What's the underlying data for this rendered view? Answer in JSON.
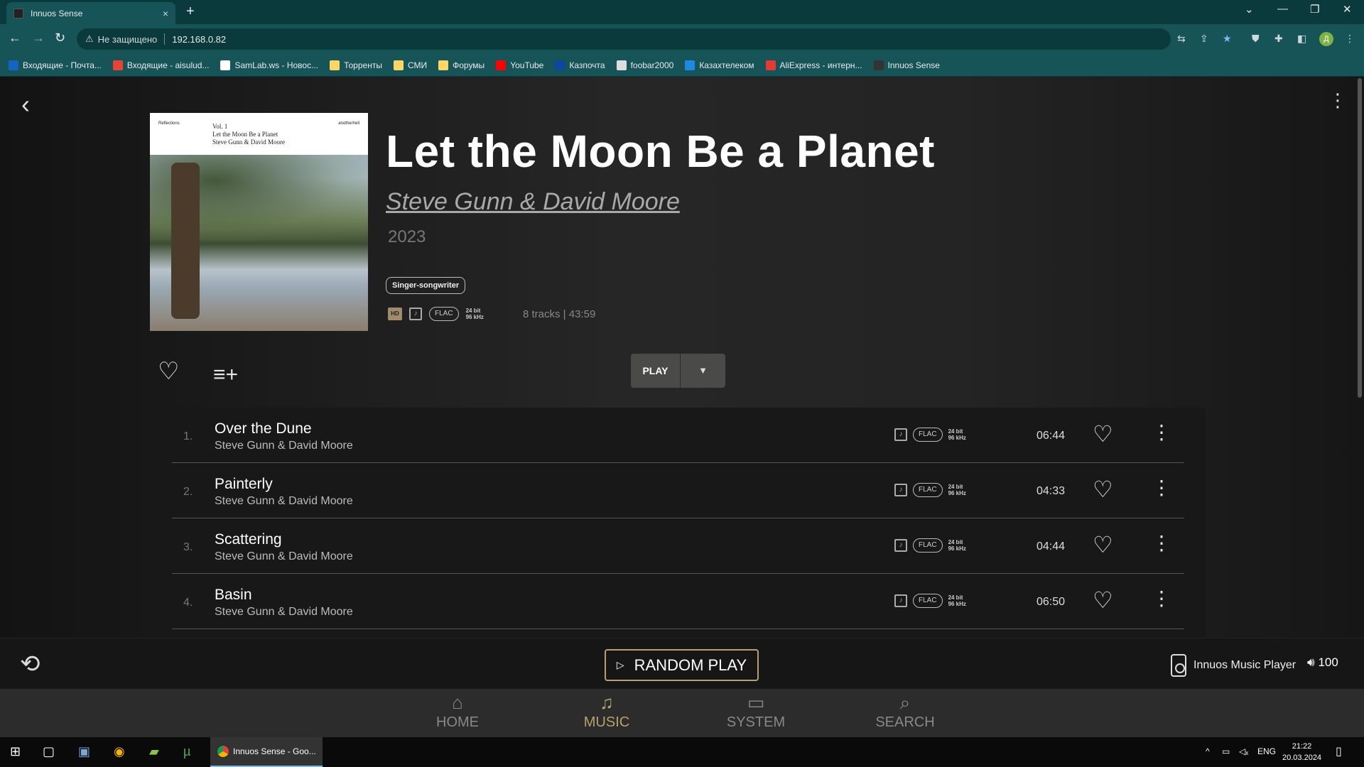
{
  "browser": {
    "tab_title": "Innuos Sense",
    "tab_close": "×",
    "new_tab": "+",
    "security_label": "Не защищено",
    "url": "192.168.0.82",
    "avatar_letter": "Д",
    "bookmarks": [
      {
        "label": "Входящие - Почта...",
        "color": "#1565c0"
      },
      {
        "label": "Входящие - aisulud...",
        "color": "#ea4335"
      },
      {
        "label": "SamLab.ws - Новос...",
        "color": "#ffffff"
      },
      {
        "label": "Торренты",
        "color": "#fdd663"
      },
      {
        "label": "СМИ",
        "color": "#fdd663"
      },
      {
        "label": "Форумы",
        "color": "#fdd663"
      },
      {
        "label": "YouTube",
        "color": "#ff0000"
      },
      {
        "label": "Казпочта",
        "color": "#0d47a1"
      },
      {
        "label": "foobar2000",
        "color": "#dddddd"
      },
      {
        "label": "Казахтелеком",
        "color": "#1e88e5"
      },
      {
        "label": "AliExpress - интерн...",
        "color": "#e53935"
      },
      {
        "label": "Innuos Sense",
        "color": "#333333"
      }
    ]
  },
  "album": {
    "title": "Let the Moon Be a Planet",
    "artist": "Steve Gunn & David Moore",
    "year": "2023",
    "genre": "Singer-songwriter",
    "format": {
      "hd": "HD",
      "codec": "FLAC",
      "bit_depth": "24 bit",
      "sample_rate": "96 kHz"
    },
    "tracks_info": "8 tracks | 43:59",
    "cover": {
      "left_text": "Reflections",
      "vol": "Vol. 1",
      "title": "Let the Moon Be a Planet",
      "artist": "Steve Gunn & David Moore",
      "right_text": "anotherhell"
    }
  },
  "actions": {
    "play_label": "PLAY"
  },
  "tracks": [
    {
      "num": "1.",
      "title": "Over the Dune",
      "artist": "Steve Gunn & David Moore",
      "codec": "FLAC",
      "bit_depth": "24 bit",
      "sample_rate": "96 kHz",
      "duration": "06:44"
    },
    {
      "num": "2.",
      "title": "Painterly",
      "artist": "Steve Gunn & David Moore",
      "codec": "FLAC",
      "bit_depth": "24 bit",
      "sample_rate": "96 kHz",
      "duration": "04:33"
    },
    {
      "num": "3.",
      "title": "Scattering",
      "artist": "Steve Gunn & David Moore",
      "codec": "FLAC",
      "bit_depth": "24 bit",
      "sample_rate": "96 kHz",
      "duration": "04:44"
    },
    {
      "num": "4.",
      "title": "Basin",
      "artist": "Steve Gunn & David Moore",
      "codec": "FLAC",
      "bit_depth": "24 bit",
      "sample_rate": "96 kHz",
      "duration": "06:50"
    }
  ],
  "player": {
    "random_play": "RANDOM PLAY",
    "device_name": "Innuos Music Player",
    "volume": "100"
  },
  "nav": {
    "home": "HOME",
    "music": "MUSIC",
    "system": "SYSTEM",
    "search": "SEARCH"
  },
  "taskbar": {
    "active_window": "Innuos Sense - Goo...",
    "lang": "ENG",
    "time": "21:22",
    "date": "20.03.2024"
  },
  "colors": {
    "accent": "#b8a06e",
    "chrome": "#175458"
  }
}
